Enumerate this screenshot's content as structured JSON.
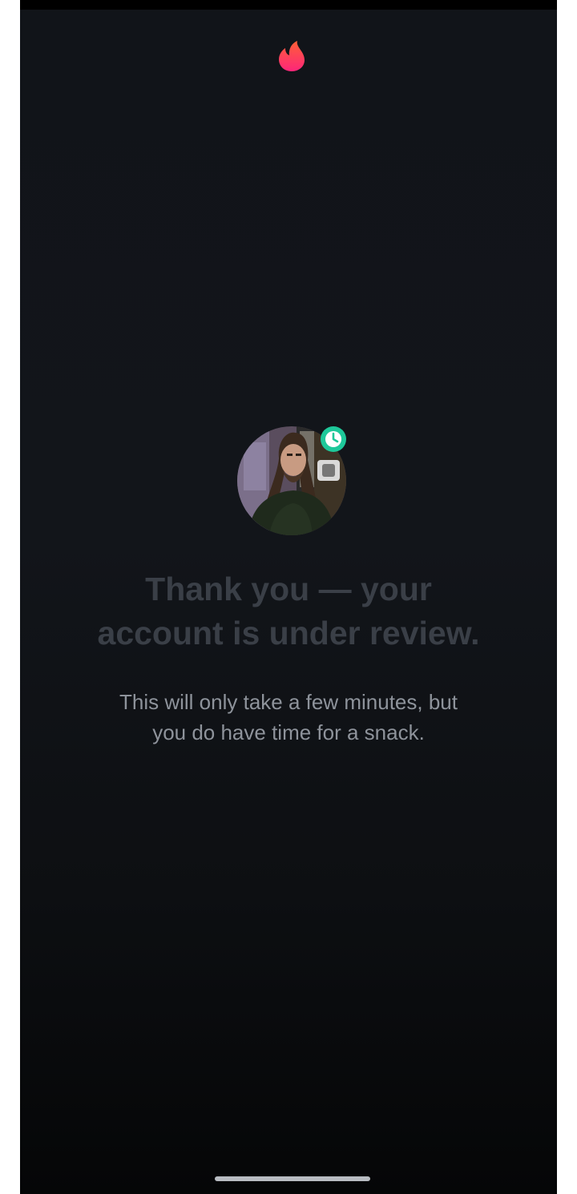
{
  "app": {
    "brand_icon": "flame-logo-icon",
    "brand_gradient": [
      "#fd267a",
      "#ff6036"
    ]
  },
  "profile": {
    "avatar": "user-profile-photo",
    "status_icon": "clock-icon",
    "status_color": "#1ec89a"
  },
  "message": {
    "title_line1": "Thank you — your",
    "title_line2": "account is under review.",
    "body_line1": "This will only take a few minutes, but",
    "body_line2": "you do have time for a snack."
  },
  "colors": {
    "background": "#12151a",
    "title": "#3a3f47",
    "body": "#8e939b"
  }
}
